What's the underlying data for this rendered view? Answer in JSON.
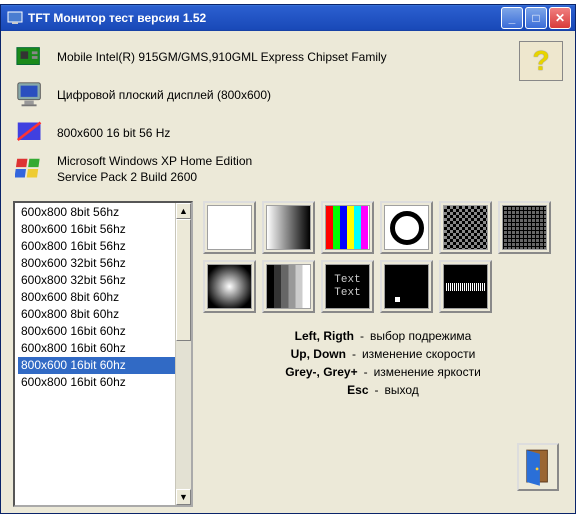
{
  "window": {
    "title": "TFT Монитор тест версия 1.52"
  },
  "info": {
    "gpu": "Mobile Intel(R) 915GM/GMS,910GML Express Chipset Family",
    "display": "Цифровой плоский дисплей (800x600)",
    "mode": "800x600 16 bit 56 Hz",
    "os_line1": "Microsoft Windows XP Home Edition",
    "os_line2": "Service Pack 2 Build 2600"
  },
  "help_label": "?",
  "modes": [
    {
      "label": "600x800  8bit  56hz",
      "selected": false
    },
    {
      "label": "800x600  16bit  56hz",
      "selected": false
    },
    {
      "label": "600x800  16bit  56hz",
      "selected": false
    },
    {
      "label": "800x600  32bit  56hz",
      "selected": false
    },
    {
      "label": "600x800  32bit  56hz",
      "selected": false
    },
    {
      "label": "800x600  8bit  60hz",
      "selected": false
    },
    {
      "label": "600x800  8bit  60hz",
      "selected": false
    },
    {
      "label": "800x600  16bit  60hz",
      "selected": false
    },
    {
      "label": "600x800  16bit  60hz",
      "selected": false
    },
    {
      "label": "800x600  16bit  60hz",
      "selected": true
    },
    {
      "label": "600x800  16bit  60hz",
      "selected": false
    }
  ],
  "tests": [
    {
      "id": "white",
      "name": "test-white"
    },
    {
      "id": "grad",
      "name": "test-gradient"
    },
    {
      "id": "bars",
      "name": "test-colorbars"
    },
    {
      "id": "circle",
      "name": "test-circle"
    },
    {
      "id": "check",
      "name": "test-checker"
    },
    {
      "id": "grid",
      "name": "test-grid"
    },
    {
      "id": "rad",
      "name": "test-radial"
    },
    {
      "id": "steps",
      "name": "test-steps"
    },
    {
      "id": "text",
      "name": "test-text",
      "t1": "Text",
      "t2": "Text"
    },
    {
      "id": "dot",
      "name": "test-pixel"
    },
    {
      "id": "wave",
      "name": "test-wave"
    }
  ],
  "keyhelp": [
    {
      "keys": "Left, Rigth",
      "desc": "выбор подрежима"
    },
    {
      "keys": "Up, Down",
      "desc": "изменение скорости"
    },
    {
      "keys": "Grey-, Grey+",
      "desc": "изменение яркости"
    },
    {
      "keys": "Esc",
      "desc": "выход"
    }
  ]
}
